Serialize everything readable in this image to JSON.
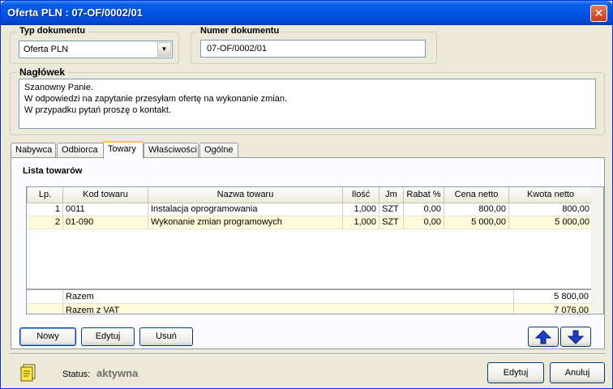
{
  "window": {
    "title": "Oferta PLN : 07-OF/0002/01",
    "close_label": "✕"
  },
  "doc_type": {
    "legend": "Typ dokumentu",
    "value": "Oferta PLN"
  },
  "doc_number": {
    "legend": "Numer dokumentu",
    "value": "07-OF/0002/01"
  },
  "header": {
    "legend": "Nagłówek",
    "lines": [
      "Szanowny Panie.",
      "W odpowiedzi na zapytanie przesyłam ofertę na wykonanie zmian.",
      "W przypadku pytań proszę o kontakt."
    ]
  },
  "tabs": [
    {
      "label": "Nabywca"
    },
    {
      "label": "Odbiorca"
    },
    {
      "label": "Towary"
    },
    {
      "label": "Właściwości"
    },
    {
      "label": "Ogólne"
    }
  ],
  "items": {
    "title": "Lista towarów",
    "columns": [
      "Lp.",
      "Kod towaru",
      "Nazwa towaru",
      "Ilość",
      "Jm",
      "Rabat %",
      "Cena netto",
      "Kwota netto"
    ],
    "rows": [
      [
        "1",
        "0011",
        "Instalacja oprogramowania",
        "1,000",
        "SZT",
        "0,00",
        "800,00",
        "800,00"
      ],
      [
        "2",
        "01-090",
        "Wykonanie zmian programowych",
        "1,000",
        "SZT",
        "0,00",
        "5 000,00",
        "5 000,00"
      ]
    ],
    "totals": [
      {
        "label": "Razem",
        "value": "5 800,00"
      },
      {
        "label": "Razem z VAT",
        "value": "7 076,00"
      }
    ]
  },
  "buttons": {
    "new": "Nowy",
    "edit_item": "Edytuj",
    "delete": "Usuń",
    "edit": "Edytuj",
    "cancel": "Anuluj"
  },
  "status": {
    "label": "Status:",
    "value": "aktywna"
  },
  "colors": {
    "titlebar": "#0054e3",
    "alt_row": "#fffbdb",
    "arrow_blue": "#1f3fc0"
  },
  "icons": {
    "move_up": "arrow-up-icon",
    "move_down": "arrow-down-icon",
    "status": "document-icon"
  }
}
